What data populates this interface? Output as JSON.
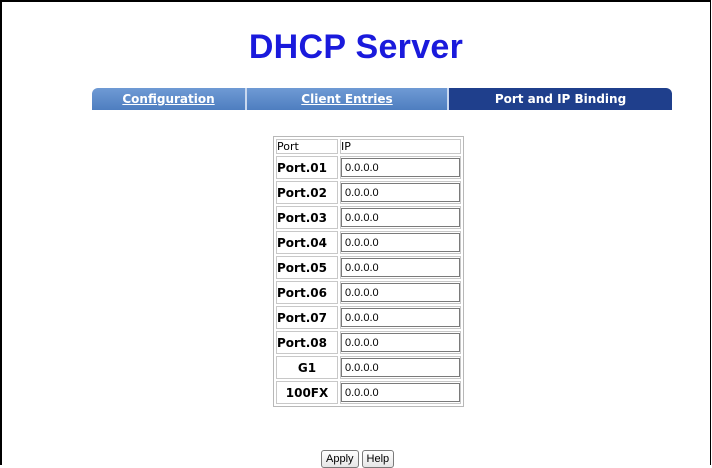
{
  "page": {
    "title": "DHCP Server"
  },
  "tabs": [
    {
      "label": "Configuration",
      "active": false
    },
    {
      "label": "Client Entries",
      "active": false
    },
    {
      "label": "Port and IP Binding",
      "active": true
    }
  ],
  "table": {
    "headers": {
      "port": "Port",
      "ip": "IP"
    },
    "rows": [
      {
        "port": "Port.01",
        "ip": "0.0.0.0"
      },
      {
        "port": "Port.02",
        "ip": "0.0.0.0"
      },
      {
        "port": "Port.03",
        "ip": "0.0.0.0"
      },
      {
        "port": "Port.04",
        "ip": "0.0.0.0"
      },
      {
        "port": "Port.05",
        "ip": "0.0.0.0"
      },
      {
        "port": "Port.06",
        "ip": "0.0.0.0"
      },
      {
        "port": "Port.07",
        "ip": "0.0.0.0"
      },
      {
        "port": "Port.08",
        "ip": "0.0.0.0"
      },
      {
        "port": "G1",
        "ip": "0.0.0.0"
      },
      {
        "port": "100FX",
        "ip": "0.0.0.0"
      }
    ]
  },
  "buttons": {
    "apply": "Apply",
    "help": "Help"
  },
  "colors": {
    "title": "#1a1adc",
    "tab_inactive": "#5b87c8",
    "tab_active": "#1f3f8c"
  }
}
